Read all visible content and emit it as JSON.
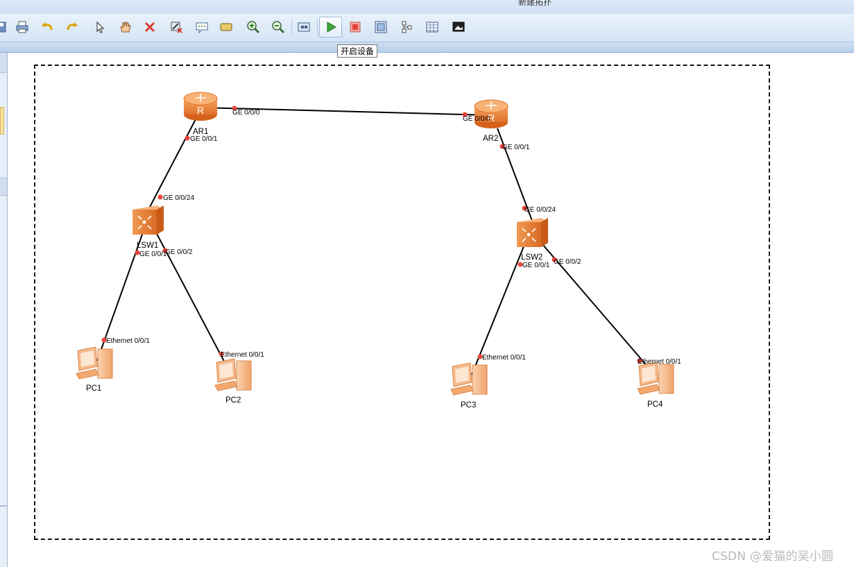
{
  "window": {
    "title": "新建拓扑"
  },
  "toolbar": {
    "items": [
      {
        "icon": "save-icon"
      },
      {
        "icon": "print-icon"
      },
      {
        "icon": "undo-icon"
      },
      {
        "icon": "redo-icon"
      },
      {
        "icon": "pointer-icon"
      },
      {
        "icon": "hand-icon"
      },
      {
        "icon": "delete-icon"
      },
      {
        "icon": "delete-link-icon"
      },
      {
        "icon": "text-note-icon"
      },
      {
        "icon": "rectangle-icon"
      },
      {
        "icon": "zoom-in-icon"
      },
      {
        "icon": "zoom-out-icon"
      },
      {
        "icon": "fit-view-icon"
      },
      {
        "icon": "start-device-icon"
      },
      {
        "icon": "stop-device-icon"
      },
      {
        "icon": "capture-icon"
      },
      {
        "icon": "topology-icon"
      },
      {
        "icon": "grid-icon"
      },
      {
        "icon": "screenshot-icon"
      }
    ],
    "tooltip": "开启设备"
  },
  "topology": {
    "devices": [
      {
        "id": "AR1",
        "type": "router",
        "label": "AR1"
      },
      {
        "id": "AR2",
        "type": "router",
        "label": "AR2"
      },
      {
        "id": "LSW1",
        "type": "switch",
        "label": "LSW1"
      },
      {
        "id": "LSW2",
        "type": "switch",
        "label": "LSW2"
      },
      {
        "id": "PC1",
        "type": "pc",
        "label": "PC1"
      },
      {
        "id": "PC2",
        "type": "pc",
        "label": "PC2"
      },
      {
        "id": "PC3",
        "type": "pc",
        "label": "PC3"
      },
      {
        "id": "PC4",
        "type": "pc",
        "label": "PC4"
      }
    ],
    "links": [
      {
        "from": "AR1",
        "from_port": "GE 0/0/0",
        "to": "AR2",
        "to_port": "GE 0/0/0"
      },
      {
        "from": "AR1",
        "from_port": "GE 0/0/1",
        "to": "LSW1",
        "to_port": "GE 0/0/24"
      },
      {
        "from": "AR2",
        "from_port": "GE 0/0/1",
        "to": "LSW2",
        "to_port": "GE 0/0/24"
      },
      {
        "from": "LSW1",
        "from_port": "GE 0/0/1",
        "to": "PC1",
        "to_port": "Ethernet 0/0/1"
      },
      {
        "from": "LSW1",
        "from_port": "GE 0/0/2",
        "to": "PC2",
        "to_port": "Ethernet 0/0/1"
      },
      {
        "from": "LSW2",
        "from_port": "GE 0/0/1",
        "to": "PC3",
        "to_port": "Ethernet 0/0/1"
      },
      {
        "from": "LSW2",
        "from_port": "GE 0/0/2",
        "to": "PC4",
        "to_port": "Ethernet 0/0/1"
      }
    ],
    "colors": {
      "router": "#f08a3e",
      "switch": "#ef7f33",
      "pc": "#f5b27a",
      "port_dot": "#e8453c",
      "link": "#000000"
    }
  },
  "watermark": "CSDN @爱猫的吴小圆"
}
